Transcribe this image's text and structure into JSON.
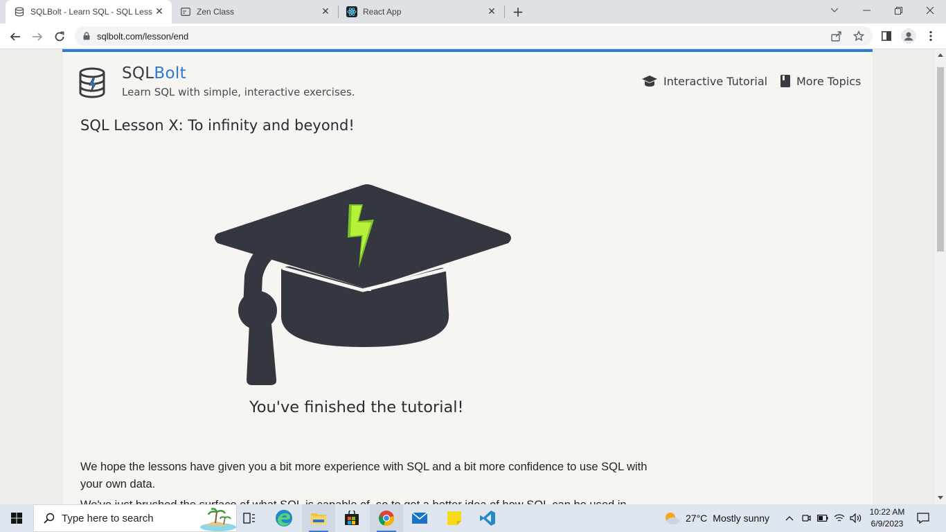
{
  "browser": {
    "tabs": [
      {
        "title": "SQLBolt - Learn SQL - SQL Lesson",
        "active": true,
        "icon": "database-icon"
      },
      {
        "title": "Zen Class",
        "active": false,
        "icon": "window-icon"
      },
      {
        "title": "React App",
        "active": false,
        "icon": "react-icon"
      }
    ],
    "url": "sqlbolt.com/lesson/end",
    "new_tab": "+"
  },
  "site": {
    "brand_prefix": "SQL",
    "brand_suffix": "Bolt",
    "tagline": "Learn SQL with simple, interactive exercises.",
    "nav": [
      {
        "label": "Interactive Tutorial",
        "icon": "graduation-cap-icon"
      },
      {
        "label": "More Topics",
        "icon": "book-icon"
      }
    ],
    "accent": "#2e7bd6"
  },
  "lesson": {
    "title": "SQL Lesson X: To infinity and beyond!",
    "finished_text": "You've finished the tutorial!",
    "paragraph1": "We hope the lessons have given you a bit more experience with SQL and a bit more confidence to use SQL with your own data.",
    "paragraph2_partial": "We've just brushed the surface of what SQL is capable of, so to get a better idea of how SQL can be used in"
  },
  "taskbar": {
    "search_placeholder": "Type here to search",
    "weather_temp": "27°C",
    "weather_desc": "Mostly sunny",
    "time": "10:22 AM",
    "date": "6/9/2023",
    "apps": [
      "task-view-icon",
      "edge-icon",
      "file-explorer-icon",
      "store-icon",
      "chrome-icon",
      "mail-icon",
      "sticky-notes-icon",
      "vscode-icon"
    ]
  }
}
